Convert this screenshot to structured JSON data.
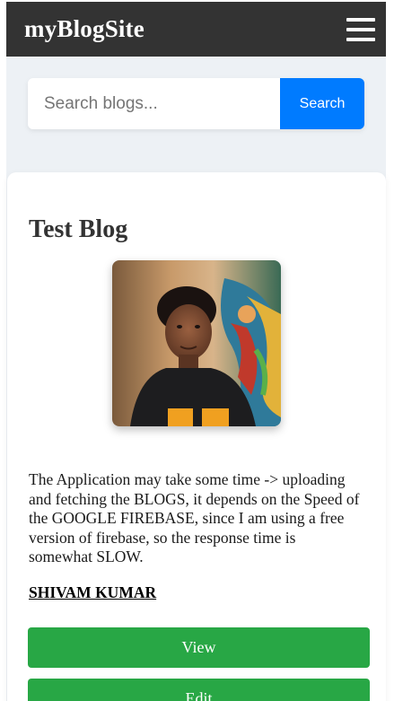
{
  "navbar": {
    "brand": "myBlogSite",
    "menu_icon": "hamburger-menu-icon"
  },
  "search": {
    "placeholder": "Search blogs...",
    "value": "",
    "button_label": "Search"
  },
  "blog": {
    "title": "Test Blog",
    "image_icon": "author-photo",
    "description": "The Application may take some time -> uploading and fetching the BLOGS, it depends on the Speed of the GOOGLE FIREBASE, since I am using a free version of firebase, so the response time is somewhat SLOW.",
    "author": "SHIVAM KUMAR",
    "view_label": "View",
    "edit_label": "Edit"
  },
  "colors": {
    "navbar_bg": "#333333",
    "page_bg": "#edf1f5",
    "search_button": "#007bff",
    "action_button": "#28a745"
  }
}
